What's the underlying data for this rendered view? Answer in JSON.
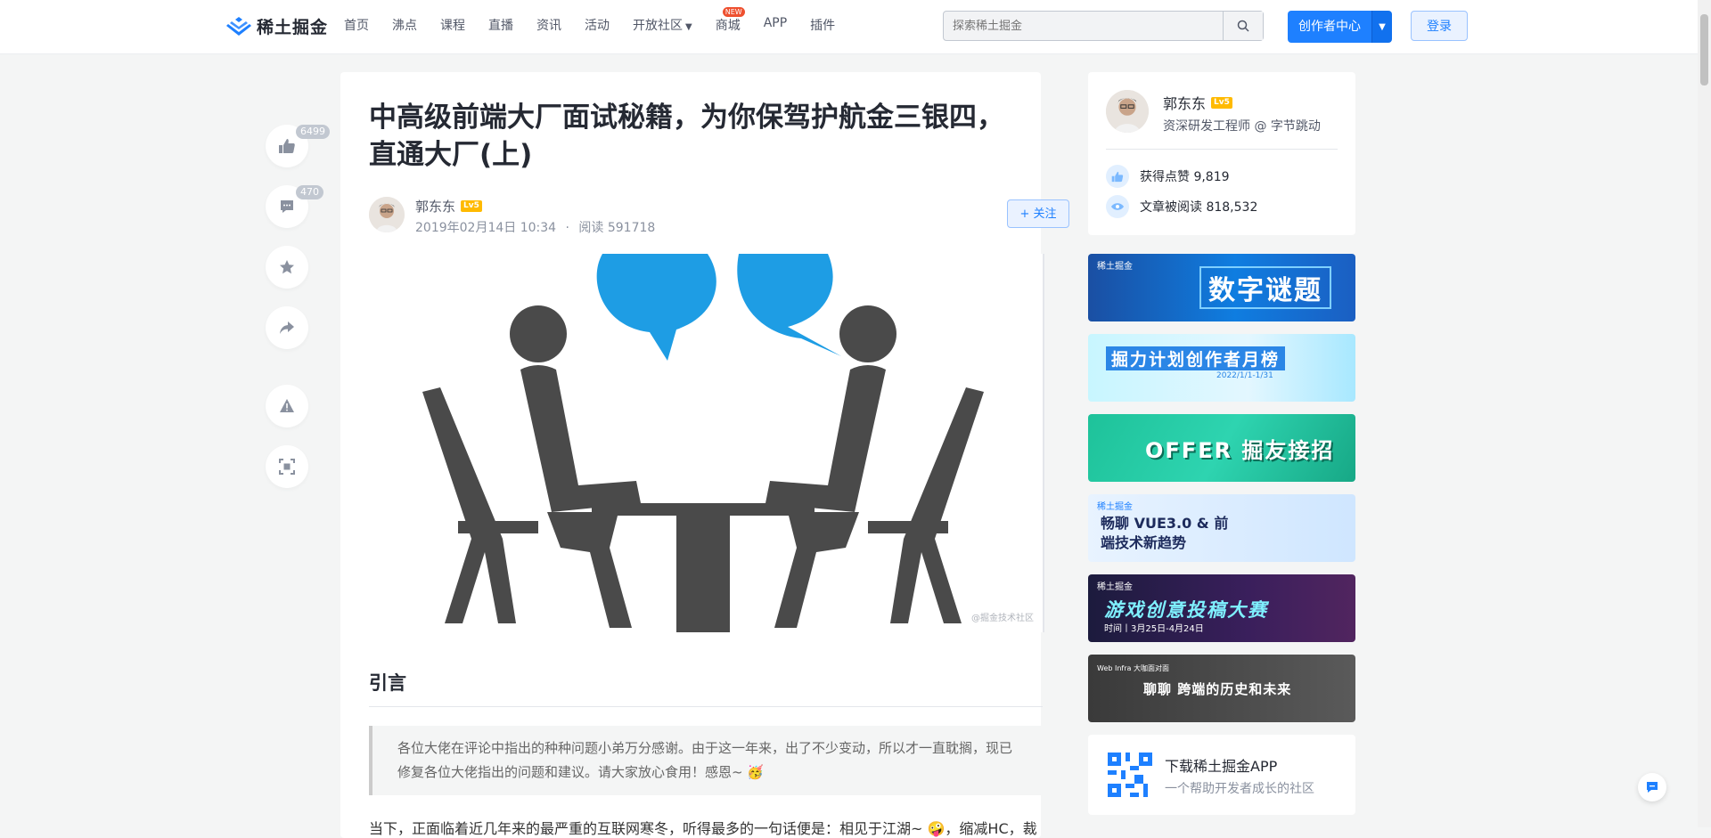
{
  "header": {
    "logo_text": "稀土掘金",
    "nav": [
      "首页",
      "沸点",
      "课程",
      "直播",
      "资讯",
      "活动",
      "开放社区",
      "商城",
      "APP",
      "插件"
    ],
    "new_badge": "NEW",
    "search_placeholder": "探索稀土掘金",
    "creator_label": "创作者中心",
    "login_label": "登录"
  },
  "side_actions": {
    "like_count": "6499",
    "comment_count": "470"
  },
  "article": {
    "title": "中高级前端大厂面试秘籍，为你保驾护航金三银四，直通大厂(上)",
    "author": "郭东东",
    "level": "Lv5",
    "date": "2019年02月14日 10:34",
    "separator": "·",
    "reads": "阅读 591718",
    "follow_label": "+ 关注",
    "cover_watermark": "@掘金技术社区",
    "section_heading": "引言",
    "quote": "各位大佬在评论中指出的种种问题小弟万分感谢。由于这一年来，出了不少变动，所以才一直耽搁，现已修复各位大佬指出的问题和建议。请大家放心食用！感恩~ 🥳",
    "para_start": "当下，正面临着近几年来的最严重的互联网寒冬，听得最多的一句话便是：相见于江湖~ 🤪，缩减HC，裁"
  },
  "author_card": {
    "name": "郭东东",
    "level": "Lv5",
    "job": "资深研发工程师 @ 字节跳动",
    "likes_label": "获得点赞",
    "likes": "9,819",
    "reads_label": "文章被阅读",
    "reads": "818,532"
  },
  "banners": [
    {
      "tag": "稀土掘金",
      "text": "数字谜题"
    },
    {
      "tag": "",
      "text": "掘力计划创作者月榜",
      "sub": "2022/1/1-1/31"
    },
    {
      "tag": "",
      "text": "OFFER 掘友接招"
    },
    {
      "tag": "稀土掘金",
      "text": "畅聊 VUE3.0 & 前端技术新趋势"
    },
    {
      "tag": "稀土掘金",
      "text": "游戏创意投稿大赛",
      "sub": "时间丨3月25日-4月24日"
    },
    {
      "tag": "Web Infra 大咖面对面",
      "text": "聊聊 跨端的历史和未来"
    }
  ],
  "app_card": {
    "title": "下载稀土掘金APP",
    "subtitle": "一个帮助开发者成长的社区"
  },
  "colors": {
    "brand": "#1e80ff",
    "bg": "#f4f5f5",
    "level": "#ffba00"
  }
}
